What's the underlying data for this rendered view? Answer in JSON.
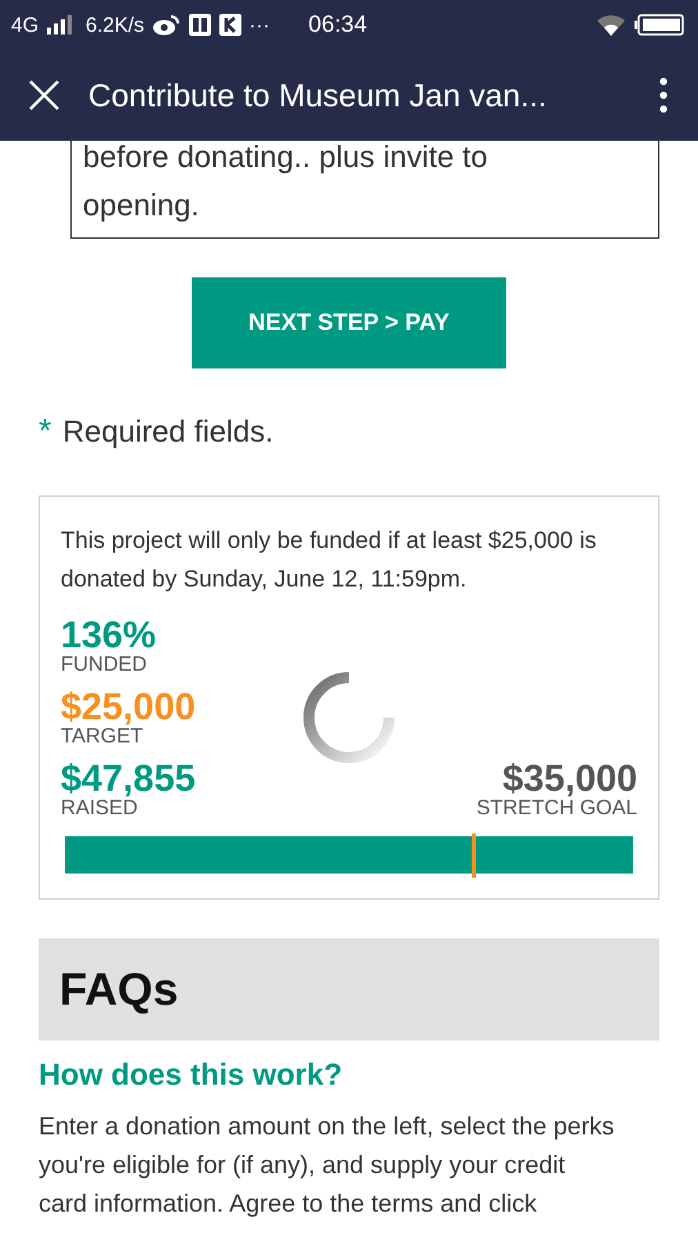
{
  "status_bar": {
    "network": "4G",
    "speed": "6.2K/s",
    "more": "···",
    "time": "06:34"
  },
  "title_bar": {
    "title": "Contribute to Museum Jan van..."
  },
  "message_field": {
    "value": "before donating.. plus invite to opening."
  },
  "next_button": {
    "label": "NEXT STEP > PAY"
  },
  "required_note": {
    "mark": "*",
    "text": "Required fields."
  },
  "funding_card": {
    "notice": "This project will only be funded if at least $25,000 is donated by Sunday, June 12, 11:59pm.",
    "stats": [
      {
        "kind": "funded",
        "value": "136%",
        "label": "FUNDED"
      },
      {
        "kind": "target",
        "value": "$25,000",
        "label": "TARGET"
      },
      {
        "kind": "raised",
        "value": "$47,855",
        "label": "RAISED"
      }
    ],
    "stretch_goal": {
      "value": "$35,000",
      "label": "STRETCH GOAL"
    },
    "progress": {
      "level": 1,
      "target_marker": {
        "level": 0.717
      }
    }
  },
  "faq": {
    "heading": "FAQs",
    "question": "How does this work?",
    "answer": "Enter a donation amount on the left, select the perks you're eligible for (if any), and supply your credit card information. Agree to the terms and click"
  }
}
